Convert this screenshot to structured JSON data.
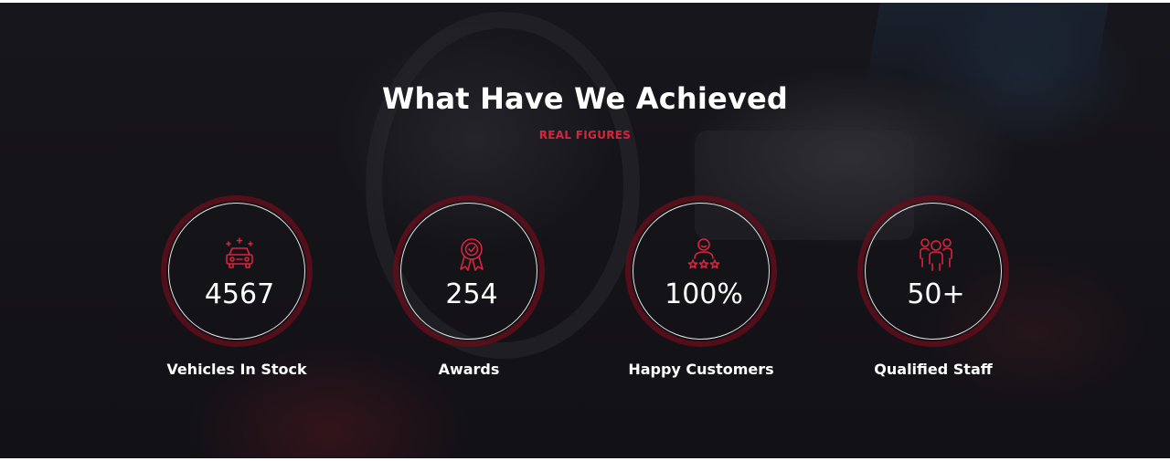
{
  "section": {
    "title": "What Have We Achieved",
    "subtitle": "REAL FIGURES"
  },
  "stats": [
    {
      "value": "4567",
      "label": "Vehicles In Stock",
      "icon": "car-sparkle-icon"
    },
    {
      "value": "254",
      "label": "Awards",
      "icon": "award-ribbon-icon"
    },
    {
      "value": "100%",
      "label": "Happy Customers",
      "icon": "customer-stars-icon"
    },
    {
      "value": "50+",
      "label": "Qualified Staff",
      "icon": "team-icon"
    }
  ],
  "colors": {
    "accent": "#d8243c",
    "ring": "#5f0e1a",
    "background": "#15141a",
    "text": "#ffffff"
  }
}
